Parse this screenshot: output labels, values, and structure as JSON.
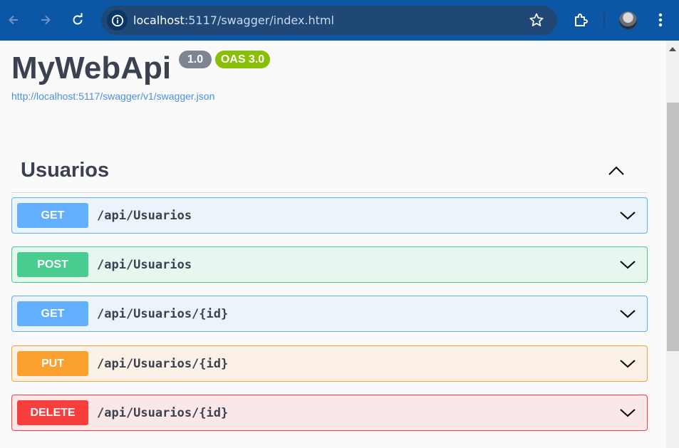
{
  "browser": {
    "url_host": "localhost",
    "url_rest": ":5117/swagger/index.html"
  },
  "page": {
    "title": "MyWebApi",
    "version": "1.0",
    "oas": "OAS 3.0",
    "spec_link": "http://localhost:5117/swagger/v1/swagger.json"
  },
  "tag": {
    "name": "Usuarios"
  },
  "operations": [
    {
      "method": "GET",
      "path": "/api/Usuarios"
    },
    {
      "method": "POST",
      "path": "/api/Usuarios"
    },
    {
      "method": "GET",
      "path": "/api/Usuarios/{id}"
    },
    {
      "method": "PUT",
      "path": "/api/Usuarios/{id}"
    },
    {
      "method": "DELETE",
      "path": "/api/Usuarios/{id}"
    }
  ],
  "colors": {
    "browser_bar": "#0b57a6",
    "get": "#61affe",
    "post": "#49cc90",
    "put": "#fca130",
    "delete": "#f93e3e"
  }
}
